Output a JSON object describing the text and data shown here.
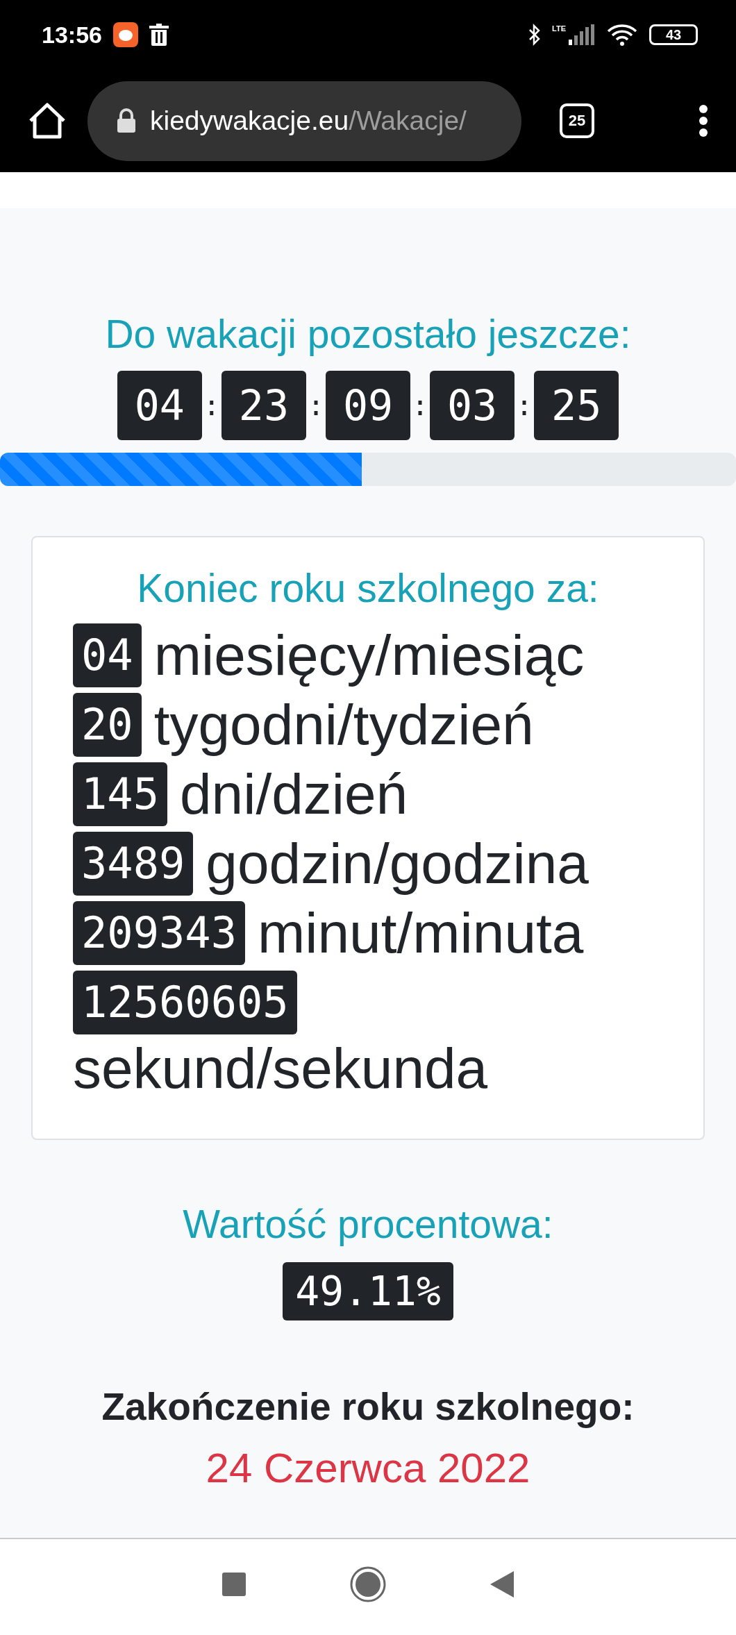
{
  "status_bar": {
    "time": "13:56",
    "network": "LTE",
    "battery": "43"
  },
  "browser_bar": {
    "domain": "kiedywakacje.eu",
    "path": "/Wakacje/",
    "tab_count": "25"
  },
  "countdown": {
    "heading": "Do wakacji pozostało jeszcze:",
    "separator": ":",
    "segments": [
      "04",
      "23",
      "09",
      "03",
      "25"
    ]
  },
  "progress": {
    "level": 0.4911
  },
  "summary_card": {
    "title": "Koniec roku szkolnego za:",
    "rows": [
      {
        "count": "04",
        "unit": "miesięcy/miesiąc"
      },
      {
        "count": "20",
        "unit": "tygodni/tydzień"
      },
      {
        "count": "145",
        "unit": "dni/dzień"
      },
      {
        "count": "3489",
        "unit": "godzin/godzina"
      },
      {
        "count": "209343",
        "unit": "minut/minuta"
      },
      {
        "count": "12560605",
        "unit": "sekund/sekunda"
      }
    ]
  },
  "percentage": {
    "heading": "Wartość procentowa:",
    "value": "49.11%"
  },
  "end_date": {
    "heading": "Zakończenie roku szkolnego:",
    "date": "24 Czerwca 2022"
  }
}
